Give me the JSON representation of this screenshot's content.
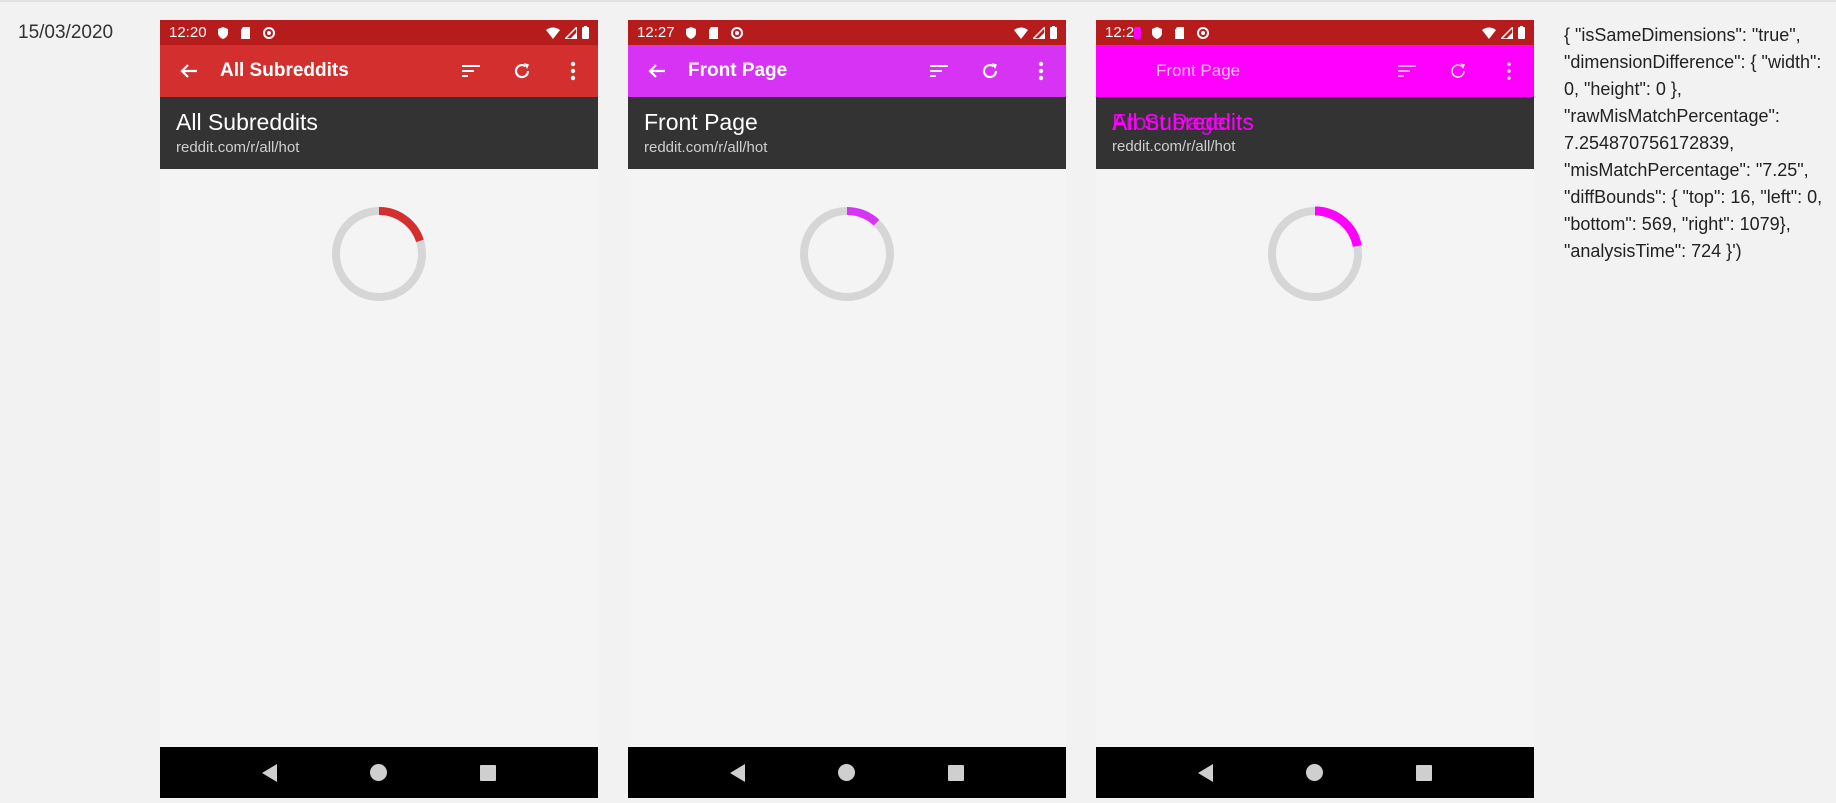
{
  "date": "15/03/2020",
  "screenshots": [
    {
      "id": "baseline",
      "status_time": "12:20",
      "toolbar_color": "#d32f2f",
      "statusbar_color": "#b71c1c",
      "toolbar_title": "All Subreddits",
      "header_title": "All Subreddits",
      "header_subtitle": "reddit.com/r/all/hot",
      "spinner_color": "#d32f2f",
      "spinner_progress": 0.2
    },
    {
      "id": "current",
      "status_time": "12:27",
      "toolbar_color": "#d633f5",
      "statusbar_color": "#b71c1c",
      "toolbar_title": "Front Page",
      "header_title": "Front Page",
      "header_subtitle": "reddit.com/r/all/hot",
      "spinner_color": "#d633f5",
      "spinner_progress": 0.12
    },
    {
      "id": "diff",
      "status_time": "12:2",
      "toolbar_color": "#ff00ff",
      "statusbar_color": "#b71c1c",
      "toolbar_title": "Front Page",
      "header_title_a": "All Subreddits",
      "header_title_b": "Front Page",
      "header_subtitle": "reddit.com/r/all/hot",
      "spinner_color": "#ff00ff",
      "spinner_progress": 0.22
    }
  ],
  "icons": {
    "back": "arrow-left-icon",
    "sort": "sort-icon",
    "refresh": "refresh-icon",
    "more": "more-vert-icon",
    "wifi": "wifi-icon",
    "signal": "signal-icon",
    "battery": "battery-icon"
  },
  "result_json": "{ \"isSameDimensions\": \"true\", \"dimensionDifference\": { \"width\": 0, \"height\": 0 }, \"rawMisMatchPercentage\": 7.254870756172839, \"misMatchPercentage\": \"7.25\", \"diffBounds\": { \"top\": 16, \"left\": 0, \"bottom\": 569, \"right\": 1079}, \"analysisTime\": 724 }')"
}
